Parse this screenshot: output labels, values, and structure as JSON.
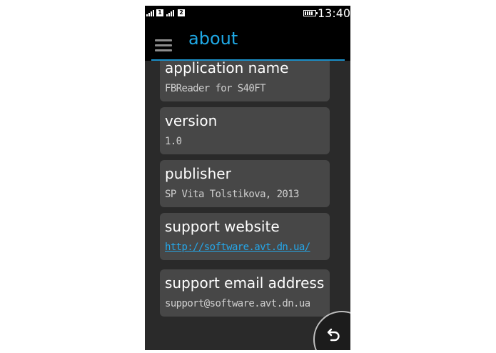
{
  "status_bar": {
    "sim1": "1",
    "sim2": "2",
    "time": "13:40",
    "icons": [
      "signal-icon",
      "signal-icon",
      "battery-icon"
    ]
  },
  "header": {
    "menu_icon": "hamburger-menu-icon",
    "title": "about"
  },
  "items": [
    {
      "label": "application name",
      "value": "FBReader for S40FT"
    },
    {
      "label": "version",
      "value": "1.0"
    },
    {
      "label": "publisher",
      "value": "SP Vita Tolstikova, 2013"
    },
    {
      "label": "support website",
      "value": "http://software.avt.dn.ua/"
    },
    {
      "label": "support email address",
      "value": "support@software.avt.dn.ua"
    }
  ],
  "back_button": {
    "icon": "back-arrow-icon"
  },
  "colors": {
    "accent": "#1fa9e6",
    "link": "#25a6e8",
    "card_background": "#474747",
    "screen_background": "#2a2a2a"
  }
}
